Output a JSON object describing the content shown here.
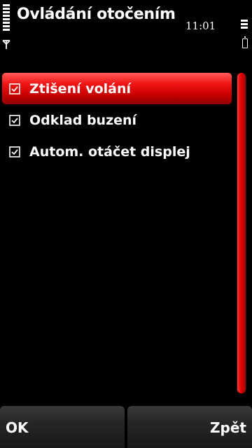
{
  "status": {
    "time": "11:01",
    "signal_level": 1.0,
    "battery_level": 1.0
  },
  "title": "Ovládání otočením",
  "items": [
    {
      "label": "Ztišení volání",
      "checked": true,
      "highlighted": true
    },
    {
      "label": "Odklad buzení",
      "checked": true,
      "highlighted": false
    },
    {
      "label": "Autom. otáčet displej",
      "checked": true,
      "highlighted": false
    }
  ],
  "scrollbar": {
    "visible_fraction": 1.0
  },
  "softkeys": {
    "left_label": "OK",
    "right_label": "Zpět"
  },
  "colors": {
    "accent": "#e60000",
    "background": "#000000",
    "text": "#ffffff"
  },
  "icons": {
    "signal": "signal-strength-icon",
    "antenna": "antenna-icon",
    "battery": "battery-icon",
    "checkbox": "checkbox-checked-icon"
  }
}
